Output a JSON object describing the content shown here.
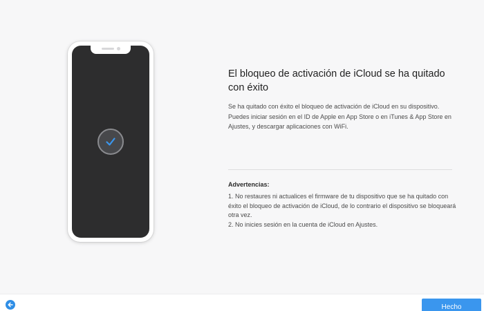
{
  "colors": {
    "accent": "#3a96ee",
    "phone_screen": "#2d2d2e",
    "check": "#3a96ee",
    "background": "#f7f7f8"
  },
  "illustration": {
    "icon": "checkmark-icon"
  },
  "main": {
    "title": "El bloqueo de activación de iCloud se ha quitado con éxito",
    "description": "Se ha quitado con éxito el bloqueo de activación de iCloud en su dispositivo. Puedes iniciar sesión en el ID de Apple en App Store o en iTunes & App Store en Ajustes, y descargar aplicaciones con WiFi."
  },
  "warnings": {
    "title": "Advertencias:",
    "items": [
      "1. No restaures ni actualices el firmware de tu dispositivo que se ha quitado con éxito el bloqueo de activación de iCloud, de lo contrario el dispositivo se bloqueará otra vez.",
      "2. No inicies sesión en la cuenta de iCloud en Ajustes."
    ]
  },
  "footer": {
    "back_icon": "arrow-left-icon",
    "done_label": "Hecho"
  }
}
